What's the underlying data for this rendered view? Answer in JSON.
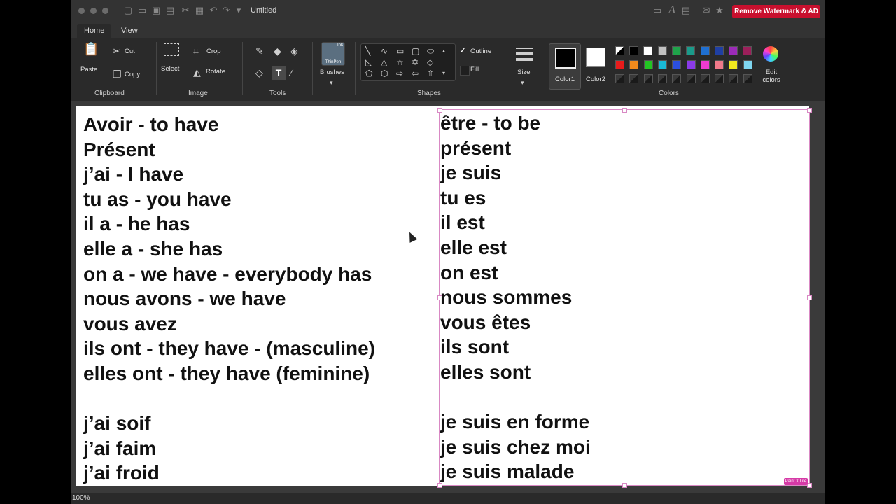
{
  "titlebar": {
    "title": "Untitled",
    "remove_button": "Remove Watermark & AD"
  },
  "tabs": [
    {
      "label": "Home"
    },
    {
      "label": "View"
    }
  ],
  "ribbon": {
    "clipboard": {
      "paste": "Paste",
      "cut": "Cut",
      "copy": "Copy",
      "label": "Clipboard"
    },
    "image": {
      "select": "Select",
      "crop": "Crop",
      "rotate": "Rotate",
      "label": "Image"
    },
    "tools": {
      "label": "Tools"
    },
    "brushes": {
      "label": "Brushes",
      "thumb_top": "Ink",
      "thumb_bottom": "ThinPen"
    },
    "shapes": {
      "outline": "Outline",
      "fill": "Fill",
      "label": "Shapes"
    },
    "size": {
      "label": "Size"
    },
    "colors": {
      "color1": "Color1",
      "color2": "Color2",
      "edit": "Edit colors",
      "label": "Colors"
    }
  },
  "palette_row1": [
    "#000000",
    "#ffffff",
    "#c0c0c0",
    "#1fa34a",
    "#1a9b8a",
    "#1f6fd1",
    "#1f3fa3",
    "#9b2bb8",
    "#9b1f5a"
  ],
  "palette_row2": [
    "#e81b1b",
    "#f08a1c",
    "#22c422",
    "#19b8d6",
    "#2b4fe0",
    "#8b3be8",
    "#f03bd1",
    "#f07a8a",
    "#f0e81f",
    "#7fd6f0"
  ],
  "document": {
    "left": [
      "Avoir - to have",
      "Présent",
      "j’ai - I have",
      "tu as - you have",
      "il a - he has",
      "elle a - she has",
      "on a - we have - everybody has",
      "nous avons - we have",
      "vous avez",
      "ils ont - they have - (masculine)",
      "elles ont - they have (feminine)",
      "",
      "j’ai soif",
      "j’ai faim",
      "j’ai froid"
    ],
    "right": [
      "être - to be",
      "présent",
      "je suis",
      "tu es",
      "il est",
      "elle est",
      "on est",
      "nous sommes",
      "vous êtes",
      "ils sont",
      "elles sont",
      "",
      "je suis en forme",
      "je suis chez moi",
      "je suis malade"
    ],
    "watermark": "Paint X Lite"
  },
  "status": {
    "zoom": "100%"
  }
}
